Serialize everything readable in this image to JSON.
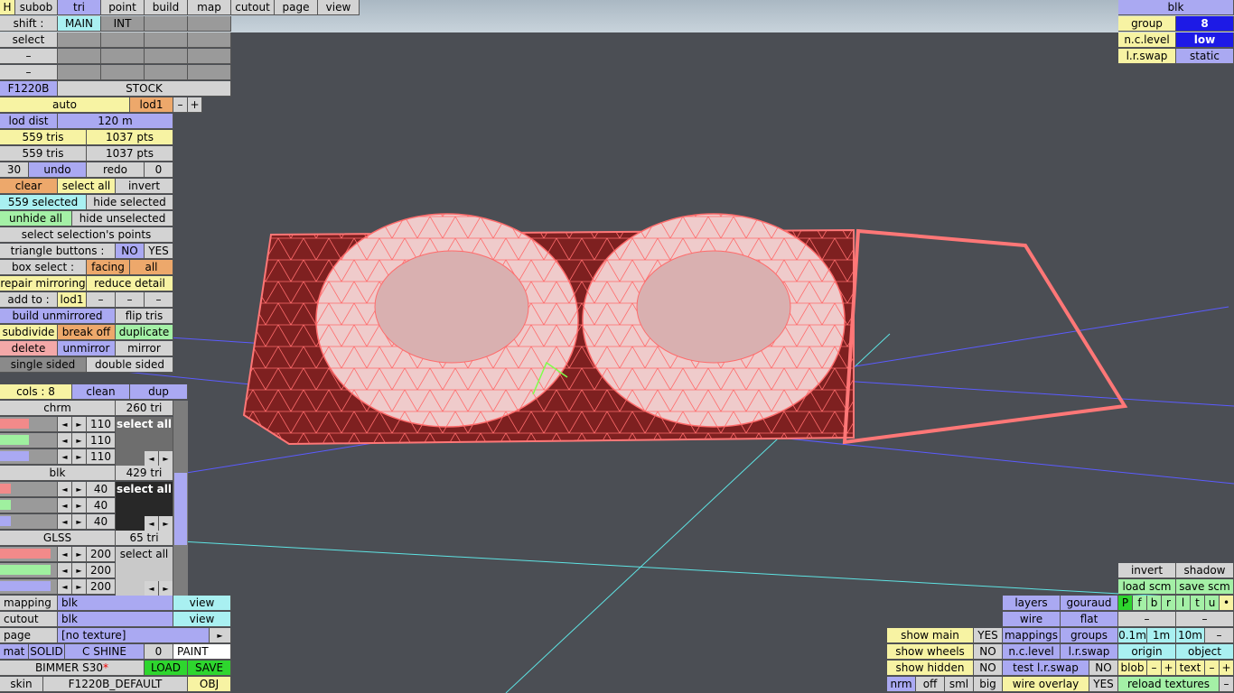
{
  "top_menu": {
    "h": "H",
    "subob": "subob",
    "tri": "tri",
    "point": "point",
    "build": "build",
    "map": "map",
    "cutout": "cutout",
    "page": "page",
    "view": "view"
  },
  "shift": {
    "label": "shift :",
    "main": "MAIN",
    "int": "INT"
  },
  "select_label": "select",
  "dash": "–",
  "object": {
    "name": "F1220B",
    "variant": "STOCK"
  },
  "lod": {
    "mode": "auto",
    "name": "lod1",
    "minus": "–",
    "plus": "+",
    "dist_label": "lod dist",
    "dist_value": "120 m"
  },
  "stats": {
    "tris1": "559 tris",
    "pts1": "1037 pts",
    "tris2": "559 tris",
    "pts2": "1037 pts"
  },
  "undo": {
    "count": "30",
    "undo": "undo",
    "redo": "redo",
    "redo_count": "0"
  },
  "selection": {
    "clear": "clear",
    "select_all": "select all",
    "invert": "invert",
    "selected": "559 selected",
    "hide_selected": "hide selected",
    "unhide_all": "unhide all",
    "hide_unselected": "hide unselected",
    "select_points": "select selection's points"
  },
  "tri_buttons": {
    "label": "triangle buttons :",
    "no": "NO",
    "yes": "YES"
  },
  "box_select": {
    "label": "box select :",
    "facing": "facing",
    "all": "all"
  },
  "tools": {
    "repair_mirroring": "repair mirroring",
    "reduce_detail": "reduce detail",
    "add_to": "add to :",
    "add_lod": "lod1",
    "build_unmirrored": "build unmirrored",
    "flip_tris": "flip tris",
    "subdivide": "subdivide",
    "break_off": "break off",
    "duplicate": "duplicate",
    "delete": "delete",
    "unmirror": "unmirror",
    "mirror": "mirror",
    "single_sided": "single sided",
    "double_sided": "double sided"
  },
  "colours": {
    "cols": "cols : 8",
    "clean": "clean",
    "dup": "dup"
  },
  "materials": [
    {
      "name": "chrm",
      "tri": "260 tri",
      "values": [
        "110",
        "110",
        "110"
      ],
      "fills": [
        0.5,
        0.5,
        0.5
      ],
      "select": "select all"
    },
    {
      "name": "blk",
      "tri": "429 tri",
      "values": [
        "40",
        "40",
        "40"
      ],
      "fills": [
        0.18,
        0.18,
        0.18
      ],
      "select": "select all"
    },
    {
      "name": "GLSS",
      "tri": "65 tri",
      "values": [
        "200",
        "200",
        "200"
      ],
      "fills": [
        0.9,
        0.9,
        0.9
      ],
      "select": "select all"
    }
  ],
  "arrows": {
    "left": "◄",
    "right": "►"
  },
  "mapping": {
    "label": "mapping",
    "value": "blk",
    "view": "view"
  },
  "cutout": {
    "label": "cutout",
    "value": "blk",
    "view": "view"
  },
  "page": {
    "label": "page",
    "value": "[no texture]",
    "arrow": "►"
  },
  "mat": {
    "label": "mat",
    "solid": "SOLID",
    "shine": "C SHINE",
    "zero": "0",
    "paint": "PAINT"
  },
  "file": {
    "name": "BIMMER S30",
    "star": "*",
    "load": "LOAD",
    "save": "SAVE"
  },
  "skin": {
    "label": "skin",
    "value": "F1220B_DEFAULT",
    "obj": "OBJ"
  },
  "right_top": {
    "title": "blk",
    "group_label": "group",
    "group_value": "8",
    "nc_label": "n.c.level",
    "nc_value": "low",
    "lr_label": "l.r.swap",
    "lr_value": "static"
  },
  "bottom_right": {
    "invert": "invert",
    "shadow": "shadow",
    "load_scm": "load scm",
    "save_scm": "save scm",
    "layers": "layers",
    "gouraud": "gouraud",
    "pfbrltu": [
      "P",
      "f",
      "b",
      "r",
      "l",
      "t",
      "u",
      "•"
    ],
    "wire": "wire",
    "flat": "flat",
    "show_main": "show main",
    "yes": "YES",
    "mappings": "mappings",
    "groups": "groups",
    "s01": "0.1m",
    "s1": "1m",
    "s10": "10m",
    "show_wheels": "show wheels",
    "no": "NO",
    "nc_level": "n.c.level",
    "lr_swap": "l.r.swap",
    "origin": "origin",
    "object": "object",
    "show_hidden": "show hidden",
    "test_lr": "test l.r.swap",
    "blob": "blob",
    "text": "text",
    "minus": "–",
    "plus": "+",
    "nrm": "nrm",
    "off": "off",
    "sml": "sml",
    "big": "big",
    "wire_overlay": "wire overlay",
    "reload": "reload textures"
  }
}
